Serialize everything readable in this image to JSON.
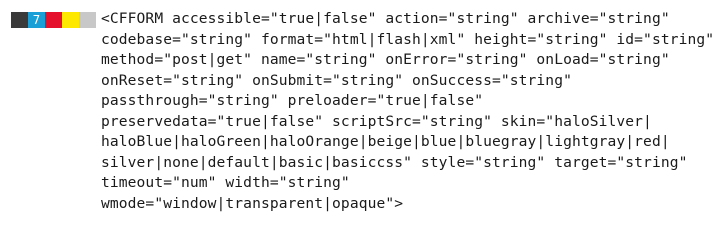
{
  "compat_bar": {
    "segments": [
      {
        "color": "#3a3a3a",
        "label": ""
      },
      {
        "color": "#1a9fd6",
        "label": "7"
      },
      {
        "color": "#e5102b",
        "label": ""
      },
      {
        "color": "#ffe800",
        "label": ""
      },
      {
        "color": "#c8c8c8",
        "label": ""
      }
    ]
  },
  "syntax": {
    "lines": [
      "<CFFORM accessible=\"true|false\" action=\"string\" archive=\"string\"",
      "codebase=\"string\" format=\"html|flash|xml\" height=\"string\" id=\"string\"",
      "method=\"post|get\" name=\"string\" onError=\"string\" onLoad=\"string\"",
      "onReset=\"string\" onSubmit=\"string\" onSuccess=\"string\"",
      "passthrough=\"string\" preloader=\"true|false\"",
      "preservedata=\"true|false\" scriptSrc=\"string\" skin=\"haloSilver|",
      "haloBlue|haloGreen|haloOrange|beige|blue|bluegray|lightgray|red|",
      "silver|none|default|basic|basiccss\" style=\"string\" target=\"string\"",
      "timeout=\"num\" width=\"string\"",
      "wmode=\"window|transparent|opaque\">"
    ]
  }
}
